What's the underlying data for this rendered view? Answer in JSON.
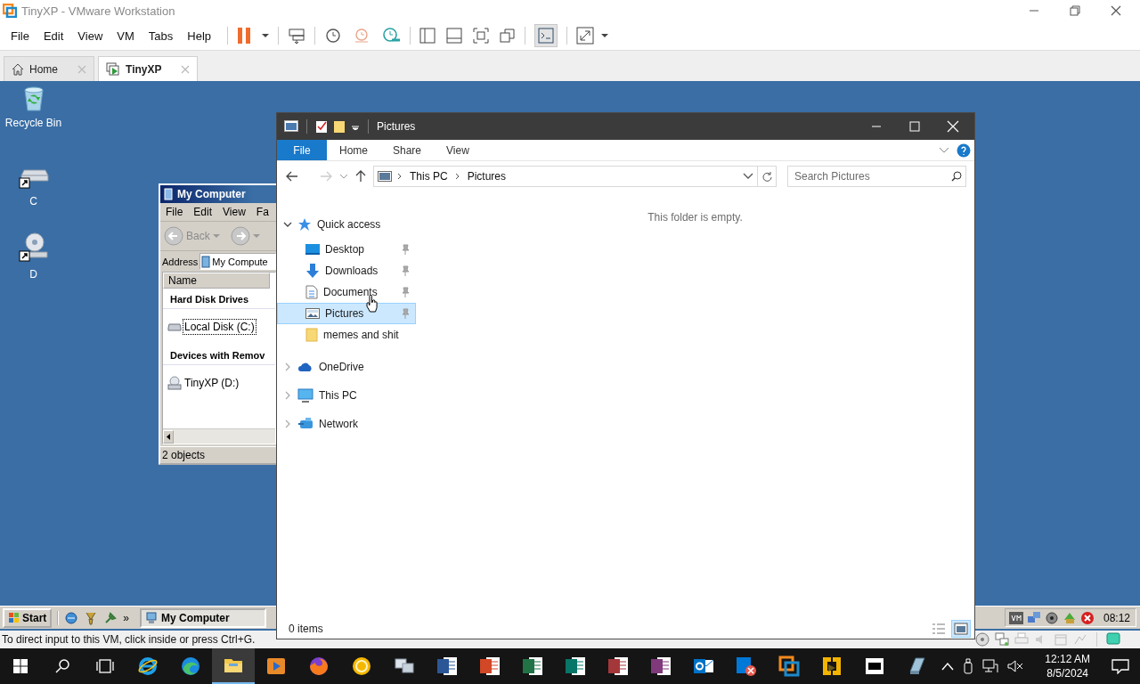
{
  "vmware": {
    "title": "TinyXP - VMware Workstation",
    "menu": [
      "File",
      "Edit",
      "View",
      "VM",
      "Tabs",
      "Help"
    ],
    "tabs": [
      {
        "label": "Home",
        "selected": false
      },
      {
        "label": "TinyXP",
        "selected": true
      }
    ],
    "status_text": "To direct input to this VM, click inside or press Ctrl+G."
  },
  "desktop": {
    "icons": [
      {
        "label": "Recycle Bin",
        "kind": "recycle"
      },
      {
        "label": "C",
        "kind": "drive"
      },
      {
        "label": "D",
        "kind": "cd"
      }
    ]
  },
  "my_computer": {
    "title": "My Computer",
    "menu": [
      "File",
      "Edit",
      "View",
      "Fa"
    ],
    "back": "Back",
    "address_label": "Address",
    "address": "My Compute",
    "column": "Name",
    "groups": [
      {
        "heading": "Hard Disk Drives",
        "items": [
          {
            "label": "Local Disk (C:)",
            "kind": "disk",
            "selected": true
          }
        ]
      },
      {
        "heading": "Devices with Remov",
        "items": [
          {
            "label": "TinyXP (D:)",
            "kind": "cd",
            "selected": false
          }
        ]
      }
    ],
    "status": "2 objects"
  },
  "explorer": {
    "title": "Pictures",
    "file_tab": "File",
    "ribbon_tabs": [
      "Home",
      "Share",
      "View"
    ],
    "breadcrumb": [
      "This PC",
      "Pictures"
    ],
    "search": {
      "placeholder": "Search Pictures"
    },
    "nav": [
      {
        "label": "Quick access",
        "kind": "star",
        "expanded": true,
        "children": [
          {
            "label": "Desktop",
            "kind": "desktop",
            "pinned": true,
            "selected": false
          },
          {
            "label": "Downloads",
            "kind": "download",
            "pinned": true,
            "selected": false
          },
          {
            "label": "Documents",
            "kind": "document",
            "pinned": true,
            "selected": false
          },
          {
            "label": "Pictures",
            "kind": "pictures",
            "pinned": true,
            "selected": true
          },
          {
            "label": "memes and shit",
            "kind": "folder",
            "pinned": false,
            "selected": false
          }
        ]
      },
      {
        "label": "OneDrive",
        "kind": "cloud",
        "expanded": false
      },
      {
        "label": "This PC",
        "kind": "pc",
        "expanded": false
      },
      {
        "label": "Network",
        "kind": "network",
        "expanded": false
      }
    ],
    "empty_message": "This folder is empty.",
    "status": "0 items"
  },
  "xp_taskbar": {
    "start": "Start",
    "more": "»",
    "tasks": [
      "My Computer"
    ],
    "clock": "08:12"
  },
  "win_taskbar": {
    "apps": [
      {
        "kind": "ie",
        "selected": false
      },
      {
        "kind": "edge",
        "selected": false
      },
      {
        "kind": "folder",
        "selected": true
      },
      {
        "kind": "media",
        "selected": false
      },
      {
        "kind": "firefox",
        "selected": false
      },
      {
        "kind": "ring",
        "selected": false
      },
      {
        "kind": "monitors",
        "selected": false
      },
      {
        "kind": "word",
        "selected": false
      },
      {
        "kind": "powerpoint",
        "selected": false
      },
      {
        "kind": "excel",
        "selected": false
      },
      {
        "kind": "publisher",
        "selected": false
      },
      {
        "kind": "access",
        "selected": false
      },
      {
        "kind": "onenote",
        "selected": false
      },
      {
        "kind": "outlook",
        "selected": false
      },
      {
        "kind": "lync",
        "selected": false
      },
      {
        "kind": "vmware",
        "selected": false
      },
      {
        "kind": "vmware-player",
        "selected": false
      },
      {
        "kind": "archiver",
        "selected": false
      },
      {
        "kind": "pane",
        "selected": false
      }
    ],
    "time": "12:12 AM",
    "date": "8/5/2024"
  }
}
